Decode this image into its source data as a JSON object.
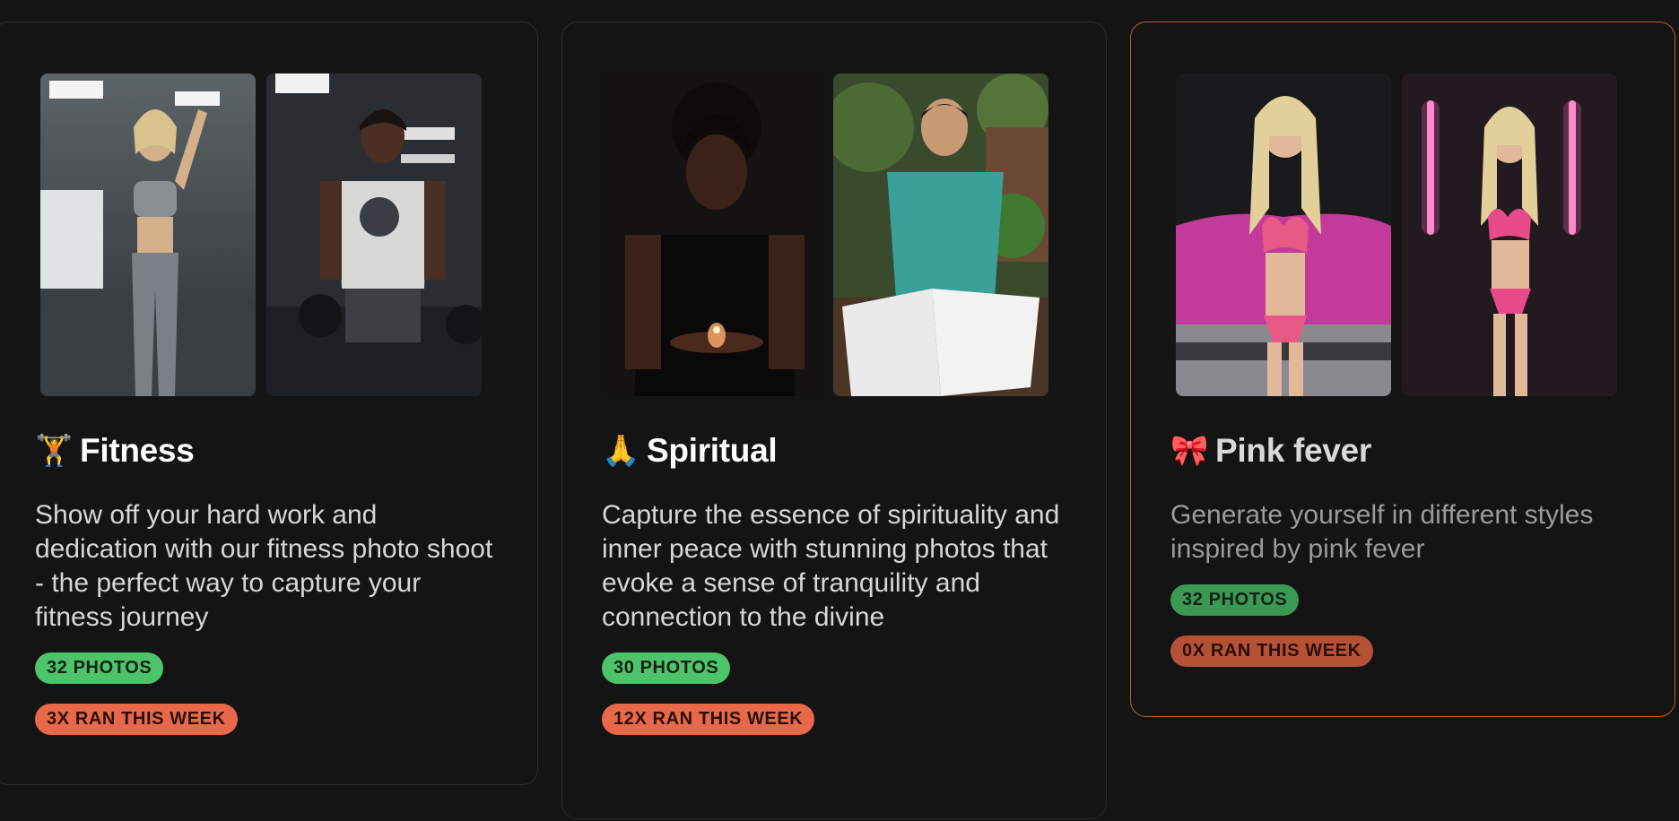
{
  "cards": [
    {
      "emoji": "🏋️",
      "emoji_icon": "weightlifter-icon",
      "title": "Fitness",
      "description": "Show off your hard work and dedication with our fitness photo shoot - the perfect way to capture your fitness journey",
      "photos_badge": "32 PHOTOS",
      "runs_badge": "3X RAN THIS WEEK"
    },
    {
      "emoji": "🙏",
      "emoji_icon": "praying-hands-icon",
      "title": "Spiritual",
      "description": "Capture the essence of spirituality and inner peace with stunning photos that evoke a sense of tranquility and connection to the divine",
      "photos_badge": "30 PHOTOS",
      "runs_badge": "12X RAN THIS WEEK"
    },
    {
      "emoji": "🎀",
      "emoji_icon": "ribbon-icon",
      "title": "Pink fever",
      "description": "Generate yourself in different styles inspired by pink fever",
      "photos_badge": "32 PHOTOS",
      "runs_badge": "0X RAN THIS WEEK"
    }
  ],
  "colors": {
    "background": "#141414",
    "card_border": "#2c2c2c",
    "selected_border": "#b5603a",
    "photos_badge": "#4dc46a",
    "runs_badge": "#e8684a"
  }
}
